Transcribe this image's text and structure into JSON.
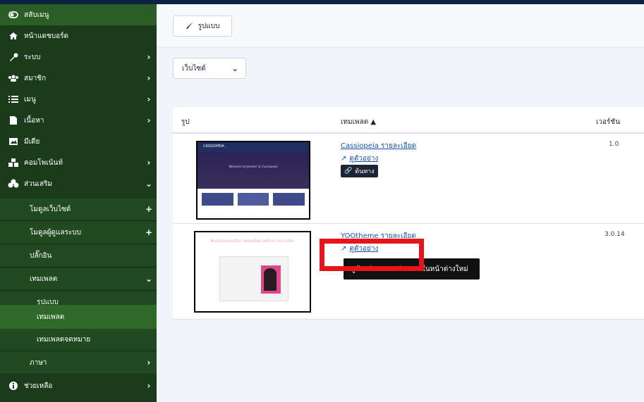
{
  "sidebar": {
    "items": [
      {
        "label": "สลับเมนู",
        "icon": "toggle-icon"
      },
      {
        "label": "หน้าแดชบอร์ด",
        "icon": "home-icon"
      },
      {
        "label": "ระบบ",
        "icon": "wrench-icon"
      },
      {
        "label": "สมาชิก",
        "icon": "users-icon"
      },
      {
        "label": "เมนู",
        "icon": "list-icon"
      },
      {
        "label": "เนื้อหา",
        "icon": "file-icon"
      },
      {
        "label": "มีเดีย",
        "icon": "image-icon"
      },
      {
        "label": "คอมโพเน้นท์",
        "icon": "cubes-icon"
      },
      {
        "label": "ส่วนเสริม",
        "icon": "puzzle-icon"
      },
      {
        "label": "โมดูลเว็บไซต์",
        "icon": ""
      },
      {
        "label": "โมดูลผู้ดูแลระบบ",
        "icon": ""
      },
      {
        "label": "ปลั๊กอิน",
        "icon": ""
      },
      {
        "label": "เทมเพลต",
        "icon": ""
      },
      {
        "label": "รูปแบบ",
        "icon": ""
      },
      {
        "label": "เทมเพลต",
        "icon": ""
      },
      {
        "label": "เทมเพลตจดหมาย",
        "icon": ""
      },
      {
        "label": "ภาษา",
        "icon": ""
      },
      {
        "label": "ช่วยเหลือ",
        "icon": "info-icon"
      }
    ]
  },
  "toolbar": {
    "style_button": "รูปแบบ"
  },
  "filter": {
    "selected": "เว็บไซต์"
  },
  "table": {
    "headers": {
      "image": "รูป",
      "template": "เทมเพลต ▲",
      "version": "เวอร์ชัน"
    },
    "rows": [
      {
        "name": "Cassiopeia รายละเอียด",
        "preview": "ดูตัวอย่าง",
        "badge": "ต้นทาง",
        "version": "1.0",
        "thumb": {
          "title": "CASSIOPEIA",
          "headline": "Welcome to Joomla! on Cassiopeia"
        }
      },
      {
        "name": "YOOtheme รายละเอียด",
        "preview": "ดูตัวอย่าง",
        "version": "3.0.14",
        "thumb": {
          "headline": "Build beautiful websites within minutes"
        }
      }
    ]
  },
  "tooltip": {
    "text": "ดูตัวอย่าง YOOtheme ในหน้าต่างใหม่"
  },
  "colors": {
    "sidebar": "#1b3c1a",
    "sidebar_active": "#2f6a2b",
    "link": "#1552a8",
    "highlight": "#e8141c"
  }
}
